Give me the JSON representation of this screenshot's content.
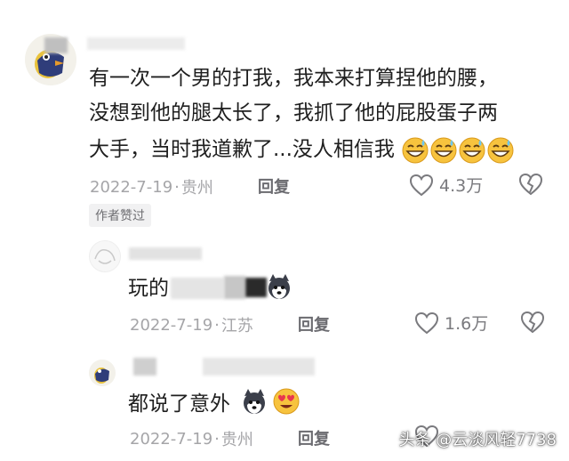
{
  "comments": [
    {
      "text_lines": [
        "有一次一个男的打我，我本来打算捏他的腰，",
        "没想到他的腿太长了，我抓了他的屁股蛋子两",
        "大手，当时我道歉了...没人相信我"
      ],
      "trailing_emojis": [
        "grin-sweat-emoji",
        "grin-sweat-emoji",
        "grin-sweat-emoji",
        "grin-sweat-emoji"
      ],
      "date": "2022-7-19",
      "location": "贵州",
      "reply_label": "回复",
      "likes": "4.3万",
      "badge": "作者赞过"
    },
    {
      "text": "玩的",
      "trailing_emojis": [
        "husky-emoji"
      ],
      "date": "2022-7-19",
      "location": "江苏",
      "reply_label": "回复",
      "likes": "1.6万"
    },
    {
      "text": "都说了意外",
      "trailing_emojis": [
        "husky-emoji",
        "heart-eyes-emoji"
      ],
      "date": "2022-7-19",
      "location": "贵州",
      "reply_label": "回复"
    }
  ],
  "separator": "·",
  "watermark": "头条 @云淡风轻7738",
  "colors": {
    "text": "#1f1f1f",
    "meta": "#a5a5a8",
    "badge_bg": "#f1f1f2"
  }
}
